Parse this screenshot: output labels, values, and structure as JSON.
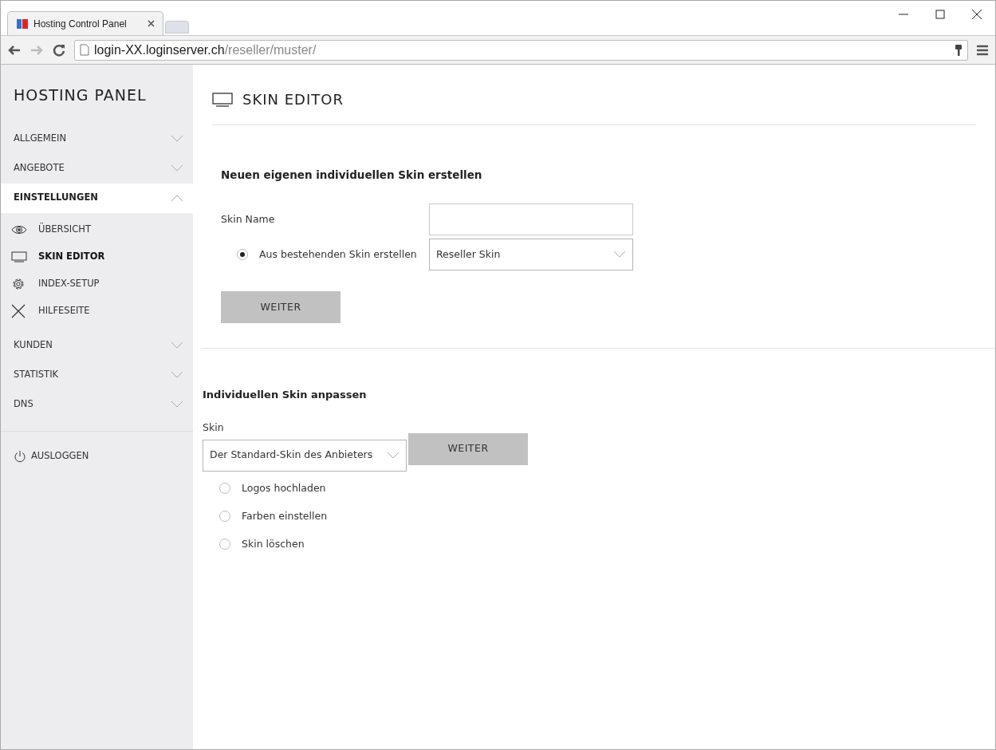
{
  "browser": {
    "tab_title": "Hosting Control Panel",
    "url_host": "login-XX.loginserver.ch",
    "url_path": "/reseller/muster/"
  },
  "sidebar": {
    "title": "HOSTING PANEL",
    "sections": [
      {
        "label": "ALLGEMEIN",
        "expanded": false
      },
      {
        "label": "ANGEBOTE",
        "expanded": false
      },
      {
        "label": "EINSTELLUNGEN",
        "expanded": true,
        "children": [
          {
            "label": "ÜBERSICHT",
            "selected": false
          },
          {
            "label": "SKIN EDITOR",
            "selected": true
          },
          {
            "label": "INDEX-SETUP",
            "selected": false
          },
          {
            "label": "HILFESEITE",
            "selected": false
          }
        ]
      },
      {
        "label": "KUNDEN",
        "expanded": false
      },
      {
        "label": "STATISTIK",
        "expanded": false
      },
      {
        "label": "DNS",
        "expanded": false
      }
    ],
    "logout": "AUSLOGGEN"
  },
  "main": {
    "title": "SKIN EDITOR",
    "create": {
      "heading": "Neuen eigenen individuellen Skin erstellen",
      "name_label": "Skin Name",
      "radio": {
        "label": "Aus bestehenden Skin erstellen",
        "selected": true
      },
      "select": "Reseller Skin",
      "button": "WEITER"
    },
    "adjust": {
      "heading": "Individuellen Skin anpassen",
      "skin_label": "Skin",
      "select": "Der Standard-Skin des Anbieters",
      "button": "WEITER",
      "options": [
        {
          "label": "Logos hochladen",
          "selected": false
        },
        {
          "label": "Farben einstellen",
          "selected": false
        },
        {
          "label": "Skin löschen",
          "selected": false
        }
      ]
    }
  }
}
